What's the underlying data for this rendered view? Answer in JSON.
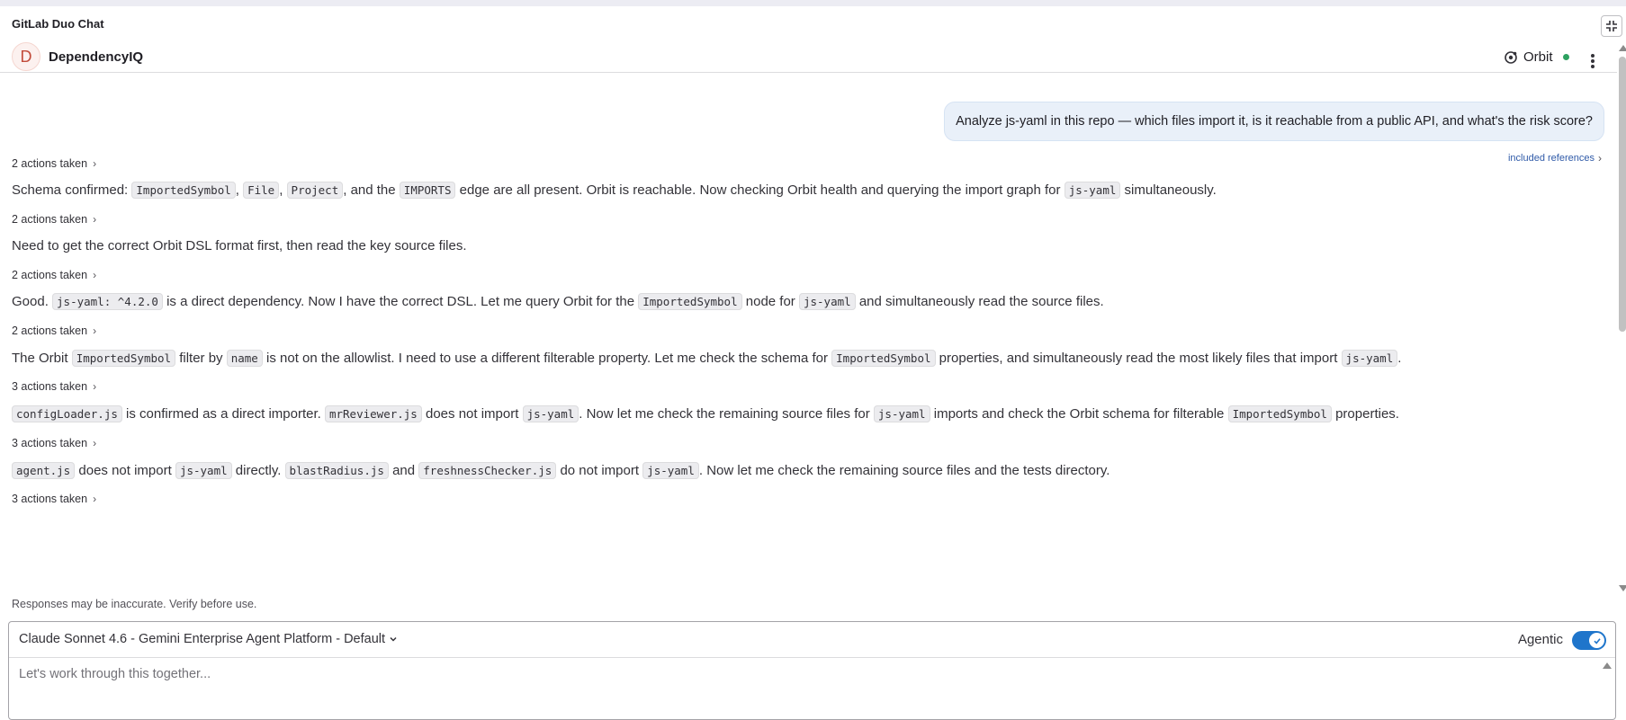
{
  "panel": {
    "title": "GitLab Duo Chat",
    "collapse_icon": "collapse-icon"
  },
  "agent": {
    "avatar_letter": "D",
    "name": "DependencyIQ",
    "orbit_label": "Orbit",
    "orbit_status_color": "#2da160"
  },
  "conversation": {
    "user_message": "Analyze js-yaml in this repo — which files import it, is it reachable from a public API, and what's the risk score?",
    "included_references_label": "included references",
    "turns": [
      {
        "actions": "2 actions taken",
        "segments": []
      },
      {
        "actions": "2 actions taken",
        "segments": [
          {
            "t": "Schema confirmed: "
          },
          {
            "c": "ImportedSymbol"
          },
          {
            "t": ", "
          },
          {
            "c": "File"
          },
          {
            "t": ", "
          },
          {
            "c": "Project"
          },
          {
            "t": ", and the "
          },
          {
            "c": "IMPORTS"
          },
          {
            "t": " edge are all present. Orbit is reachable. Now checking Orbit health and querying the import graph for "
          },
          {
            "c": "js-yaml"
          },
          {
            "t": " simultaneously."
          }
        ]
      },
      {
        "actions": "2 actions taken",
        "segments": [
          {
            "t": "Need to get the correct Orbit DSL format first, then read the key source files."
          }
        ]
      },
      {
        "actions": "2 actions taken",
        "segments": [
          {
            "t": "Good. "
          },
          {
            "c": "js-yaml: ^4.2.0"
          },
          {
            "t": " is a direct dependency. Now I have the correct DSL. Let me query Orbit for the "
          },
          {
            "c": "ImportedSymbol"
          },
          {
            "t": " node for "
          },
          {
            "c": "js-yaml"
          },
          {
            "t": " and simultaneously read the source files."
          }
        ]
      },
      {
        "actions": "3 actions taken",
        "segments": [
          {
            "t": "The Orbit "
          },
          {
            "c": "ImportedSymbol"
          },
          {
            "t": " filter by "
          },
          {
            "c": "name"
          },
          {
            "t": " is not on the allowlist. I need to use a different filterable property. Let me check the schema for "
          },
          {
            "c": "ImportedSymbol"
          },
          {
            "t": " properties, and simultaneously read the most likely files that import "
          },
          {
            "c": "js-yaml"
          },
          {
            "t": "."
          }
        ]
      },
      {
        "actions": "3 actions taken",
        "segments": [
          {
            "c": "configLoader.js"
          },
          {
            "t": " is confirmed as a direct importer. "
          },
          {
            "c": "mrReviewer.js"
          },
          {
            "t": " does not import "
          },
          {
            "c": "js-yaml"
          },
          {
            "t": ". Now let me check the remaining source files for "
          },
          {
            "c": "js-yaml"
          },
          {
            "t": " imports and check the Orbit schema for filterable "
          },
          {
            "c": "ImportedSymbol"
          },
          {
            "t": " properties."
          }
        ]
      },
      {
        "actions": "3 actions taken",
        "segments": [
          {
            "c": "agent.js"
          },
          {
            "t": " does not import "
          },
          {
            "c": "js-yaml"
          },
          {
            "t": " directly. "
          },
          {
            "c": "blastRadius.js"
          },
          {
            "t": " and "
          },
          {
            "c": "freshnessChecker.js"
          },
          {
            "t": " do not import "
          },
          {
            "c": "js-yaml"
          },
          {
            "t": ". Now let me check the remaining source files and the tests directory."
          }
        ]
      }
    ]
  },
  "disclaimer": "Responses may be inaccurate. Verify before use.",
  "composer": {
    "model": "Claude Sonnet 4.6 - Gemini Enterprise Agent Platform - Default",
    "agentic_label": "Agentic",
    "agentic_enabled": true,
    "toggle_color": "#1f75cb",
    "placeholder": "Let's work through this together..."
  }
}
